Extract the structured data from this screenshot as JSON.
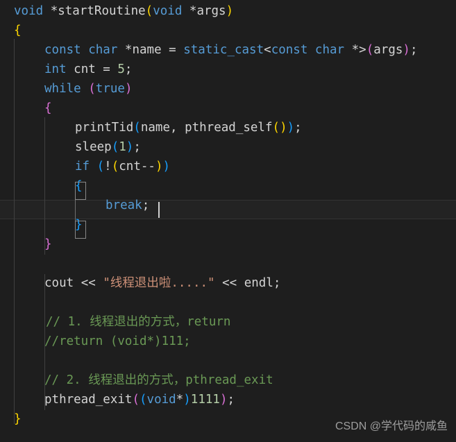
{
  "editor": {
    "language": "cpp",
    "theme": "dark-plus",
    "background_color": "#1e1e1e",
    "current_line_background": "#232323",
    "colors": {
      "keyword": "#569cd6",
      "identifier": "#d4d4d4",
      "variable": "#9cdcfe",
      "number": "#b5cea8",
      "string": "#ce9178",
      "comment": "#6a9955",
      "bracket_level_1": "#ffd700",
      "bracket_level_2": "#da70d6",
      "bracket_level_3": "#179fff",
      "indent_guide": "#404040",
      "indent_guide_active": "#707070",
      "matched_bracket_border": "#888888",
      "watermark": "#9e9e9e"
    },
    "cursor_line_index": 9,
    "lines": [
      {
        "n": 0,
        "text": "void *startRoutine(void *args)"
      },
      {
        "n": 1,
        "text": "{"
      },
      {
        "n": 2,
        "text": "    const char *name = static_cast<const char *>(args);"
      },
      {
        "n": 3,
        "text": "    int cnt = 5;"
      },
      {
        "n": 4,
        "text": "    while (true)"
      },
      {
        "n": 5,
        "text": "    {"
      },
      {
        "n": 6,
        "text": "        printTid(name, pthread_self());"
      },
      {
        "n": 7,
        "text": "        sleep(1);"
      },
      {
        "n": 8,
        "text": "        if (!(cnt--))"
      },
      {
        "n": 9,
        "text": "        {"
      },
      {
        "n": 10,
        "text": "            break;"
      },
      {
        "n": 11,
        "text": "        }"
      },
      {
        "n": 12,
        "text": "    }"
      },
      {
        "n": 13,
        "text": ""
      },
      {
        "n": 14,
        "text": "    cout << \"线程退出啦.....\" << endl;"
      },
      {
        "n": 15,
        "text": ""
      },
      {
        "n": 16,
        "text": "    // 1. 线程退出的方式，return"
      },
      {
        "n": 17,
        "text": "    //return (void*)111;"
      },
      {
        "n": 18,
        "text": ""
      },
      {
        "n": 19,
        "text": "    // 2. 线程退出的方式，pthread_exit"
      },
      {
        "n": 20,
        "text": "    pthread_exit((void*)1111);"
      },
      {
        "n": 21,
        "text": "}"
      }
    ],
    "tokens": {
      "l0": {
        "t1": "void",
        "t2": " *",
        "t3": "startRoutine",
        "t4": "(",
        "t5": "void",
        "t6": " *",
        "t7": "args",
        "t8": ")"
      },
      "l1": {
        "t1": "{"
      },
      "l2": {
        "t1": "const",
        "t2": " ",
        "t3": "char",
        "t4": " *",
        "t5": "name",
        "t6": " = ",
        "t7": "static_cast",
        "t8": "<",
        "t9": "const",
        "t10": " ",
        "t11": "char",
        "t12": " *",
        "t13": ">",
        "t14": "(",
        "t15": "args",
        "t16": ")",
        "t17": ";"
      },
      "l3": {
        "t1": "int",
        "t2": " ",
        "t3": "cnt",
        "t4": " = ",
        "t5": "5",
        "t6": ";"
      },
      "l4": {
        "t1": "while",
        "t2": " ",
        "t3": "(",
        "t4": "true",
        "t5": ")"
      },
      "l5": {
        "t1": "{"
      },
      "l6": {
        "t1": "printTid",
        "t2": "(",
        "t3": "name",
        "t4": ", ",
        "t5": "pthread_self",
        "t6": "(",
        "t7": ")",
        "t8": ")",
        "t9": ";"
      },
      "l7": {
        "t1": "sleep",
        "t2": "(",
        "t3": "1",
        "t4": ")",
        "t5": ";"
      },
      "l8": {
        "t1": "if",
        "t2": " ",
        "t3": "(",
        "t4": "!",
        "t5": "(",
        "t6": "cnt",
        "t7": "--",
        "t8": ")",
        "t9": ")"
      },
      "l9": {
        "t1": "{"
      },
      "l10": {
        "t1": "break",
        "t2": ";"
      },
      "l11": {
        "t1": "}"
      },
      "l12": {
        "t1": "}"
      },
      "l14": {
        "t1": "cout",
        "t2": " << ",
        "t3": "\"线程退出啦.....\"",
        "t4": " << ",
        "t5": "endl",
        "t6": ";"
      },
      "l16": {
        "t1": "// 1. 线程退出的方式，return"
      },
      "l17": {
        "t1": "//return (void*)111;"
      },
      "l19": {
        "t1": "// 2. 线程退出的方式，pthread_exit"
      },
      "l20": {
        "t1": "pthread_exit",
        "t2": "(",
        "t3": "(",
        "t4": "void",
        "t5": "*",
        "t6": ")",
        "t7": "1111",
        "t8": ")",
        "t9": ";"
      },
      "l21": {
        "t1": "}"
      }
    }
  },
  "watermark": {
    "text": "CSDN @学代码的咸鱼"
  }
}
